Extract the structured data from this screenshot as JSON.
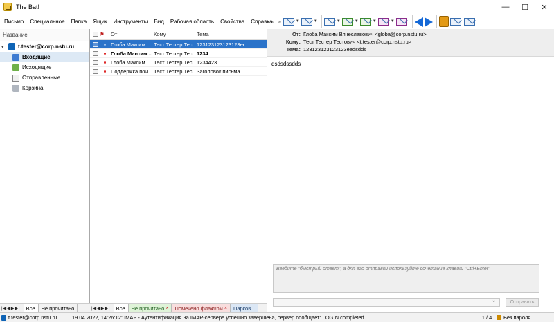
{
  "window": {
    "title": "The Bat!",
    "controls": [
      "—",
      "☐",
      "✕"
    ]
  },
  "menu": [
    "Письмо",
    "Специальное",
    "Папка",
    "Ящик",
    "Инструменты",
    "Вид",
    "Рабочая область",
    "Свойства",
    "Справка"
  ],
  "folders": {
    "header": "Название",
    "account": "t.tester@corp.nstu.ru",
    "items": [
      "Входящие",
      "Исходящие",
      "Отправленные",
      "Корзина"
    ]
  },
  "list": {
    "headers": {
      "from": "От",
      "to": "Кому",
      "subject": "Тема"
    },
    "rows": [
      {
        "from": "Глоба Максим ...",
        "to": "Тест Тестер Тес...",
        "subject": "123123123123123eedsdds"
      },
      {
        "from": "Глоба Максим ...",
        "to": "Тест Тестер Тес...",
        "subject": "1234"
      },
      {
        "from": "Глоба Максим ...",
        "to": "Тест Тестер Тес...",
        "subject": "1234423"
      },
      {
        "from": "Поддержка поч...",
        "to": "Тест Тестер Тес...",
        "subject": "Заголовок письма"
      }
    ]
  },
  "message": {
    "labels": {
      "from": "От:",
      "to": "Кому:",
      "subject": "Тема:"
    },
    "from": "Глоба Максим Вячеславович <globa@corp.nstu.ru>",
    "to": "Тест Тестер Тестович <t.tester@corp.nstu.ru>",
    "subject": "123123123123123eedsdds",
    "body": "dsdsdssdds"
  },
  "quick_reply": {
    "placeholder": "Введите \"быстрый ответ\", а для его отправки используйте сочетание клавиш \"Ctrl+Enter\"",
    "send": "Отправить"
  },
  "tabs_left": {
    "all": "Все",
    "unread": "Не прочитано"
  },
  "tabs_mid": {
    "all": "Все",
    "unread": "Не прочитано",
    "flagged": "Помечено флажком",
    "parked": "Парков..."
  },
  "status": {
    "account": "t.tester@corp.nstu.ru",
    "log": "19.04.2022, 14:26:12: IMAP  - Аутентификация на IMAP-сервере успешно завершена, сервер сообщает: LOGIN completed.",
    "count": "1 / 4",
    "password": "Без пароля"
  },
  "colors": {
    "accent": "#2b73c9",
    "arrow": "#1468d6"
  }
}
